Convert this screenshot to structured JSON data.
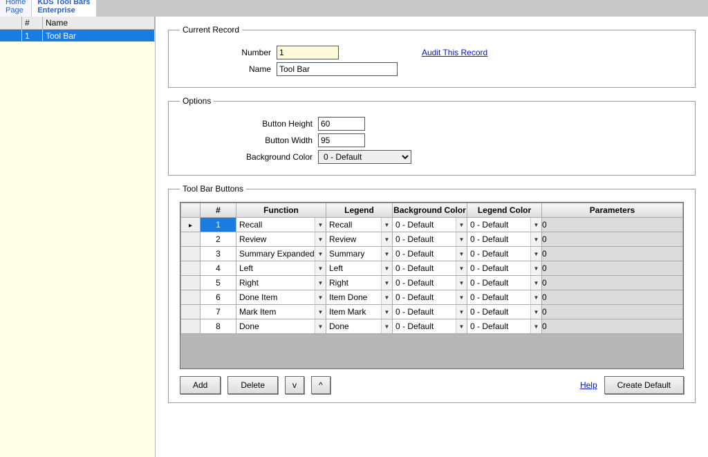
{
  "tabs": {
    "home": "Home\nPage",
    "active": "KDS Tool Bars\nEnterprise"
  },
  "leftGrid": {
    "headers": {
      "gutter": "",
      "num": "#",
      "name": "Name"
    },
    "rows": [
      {
        "num": "1",
        "name": "Tool Bar"
      }
    ]
  },
  "currentRecord": {
    "legend": "Current Record",
    "numberLabel": "Number",
    "numberValue": "1",
    "nameLabel": "Name",
    "nameValue": "Tool Bar",
    "auditLink": "Audit This Record"
  },
  "options": {
    "legend": "Options",
    "heightLabel": "Button Height",
    "heightValue": "60",
    "widthLabel": "Button Width",
    "widthValue": "95",
    "bgLabel": "Background Color",
    "bgValue": "0 - Default"
  },
  "toolbarButtons": {
    "legend": "Tool Bar Buttons",
    "headers": {
      "num": "#",
      "function": "Function",
      "legend": "Legend",
      "bgColor": "Background Color",
      "legendColor": "Legend Color",
      "parameters": "Parameters"
    },
    "rows": [
      {
        "num": "1",
        "function": "Recall",
        "legend": "Recall",
        "bg": "0 - Default",
        "lg": "0 - Default",
        "param": "0"
      },
      {
        "num": "2",
        "function": "Review",
        "legend": "Review",
        "bg": "0 - Default",
        "lg": "0 - Default",
        "param": "0"
      },
      {
        "num": "3",
        "function": "Summary Expanded",
        "legend": "Summary",
        "bg": "0 - Default",
        "lg": "0 - Default",
        "param": "0"
      },
      {
        "num": "4",
        "function": "Left",
        "legend": "Left",
        "bg": "0 - Default",
        "lg": "0 - Default",
        "param": "0"
      },
      {
        "num": "5",
        "function": "Right",
        "legend": "Right",
        "bg": "0 - Default",
        "lg": "0 - Default",
        "param": "0"
      },
      {
        "num": "6",
        "function": "Done Item",
        "legend": "Item Done",
        "bg": "0 - Default",
        "lg": "0 - Default",
        "param": "0"
      },
      {
        "num": "7",
        "function": "Mark Item",
        "legend": "Item Mark",
        "bg": "0 - Default",
        "lg": "0 - Default",
        "param": "0"
      },
      {
        "num": "8",
        "function": "Done",
        "legend": "Done",
        "bg": "0 - Default",
        "lg": "0 - Default",
        "param": "0"
      }
    ]
  },
  "buttons": {
    "add": "Add",
    "delete": "Delete",
    "down": "v",
    "up": "^",
    "help": "Help",
    "createDefault": "Create Default"
  }
}
